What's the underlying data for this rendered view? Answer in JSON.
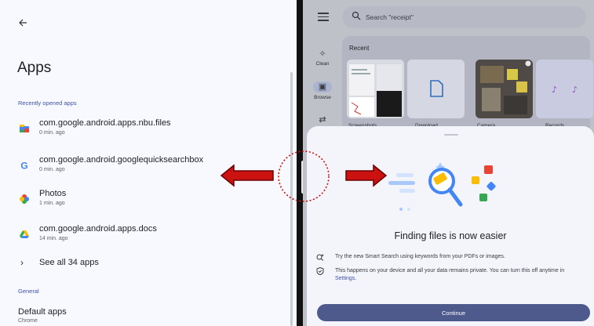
{
  "settings": {
    "back_icon": "arrow-back-icon",
    "title": "Apps",
    "recent_section_label": "Recently opened apps",
    "recent_apps": [
      {
        "name": "com.google.android.apps.nbu.files",
        "time": "0 min. ago",
        "icon": "files-app-icon"
      },
      {
        "name": "com.google.android.googlequicksearchbox",
        "time": "0 min. ago",
        "icon": "google-app-icon"
      },
      {
        "name": "Photos",
        "time": "1 min. ago",
        "icon": "photos-app-icon"
      },
      {
        "name": "com.google.android.apps.docs",
        "time": "14 min. ago",
        "icon": "drive-app-icon"
      }
    ],
    "see_all_label": "See all 34 apps",
    "general_section_label": "General",
    "default_apps_label": "Default apps",
    "default_apps_value": "Chrome"
  },
  "files": {
    "search_placeholder": "Search \"receipt\"",
    "rail": [
      {
        "label": "Clean",
        "icon": "sparkle-icon"
      },
      {
        "label": "Browse",
        "icon": "browse-folder-icon"
      }
    ],
    "recent_title": "Recent",
    "recent_items": [
      "Screenshots",
      "Download",
      "Camera",
      "Records"
    ]
  },
  "sheet": {
    "title": "Finding files is now easier",
    "line1": "Try the new Smart Search using keywords from your PDFs or images.",
    "line2_text": "This happens on your device and all your data remains private. You can turn this off anytime in",
    "line2_link": "Settings",
    "line2_end": ".",
    "continue_label": "Continue"
  },
  "colors": {
    "accent": "#3f51a8",
    "button": "#4e5a8c",
    "annotation_red": "#cc1111",
    "divider": "#111111"
  }
}
